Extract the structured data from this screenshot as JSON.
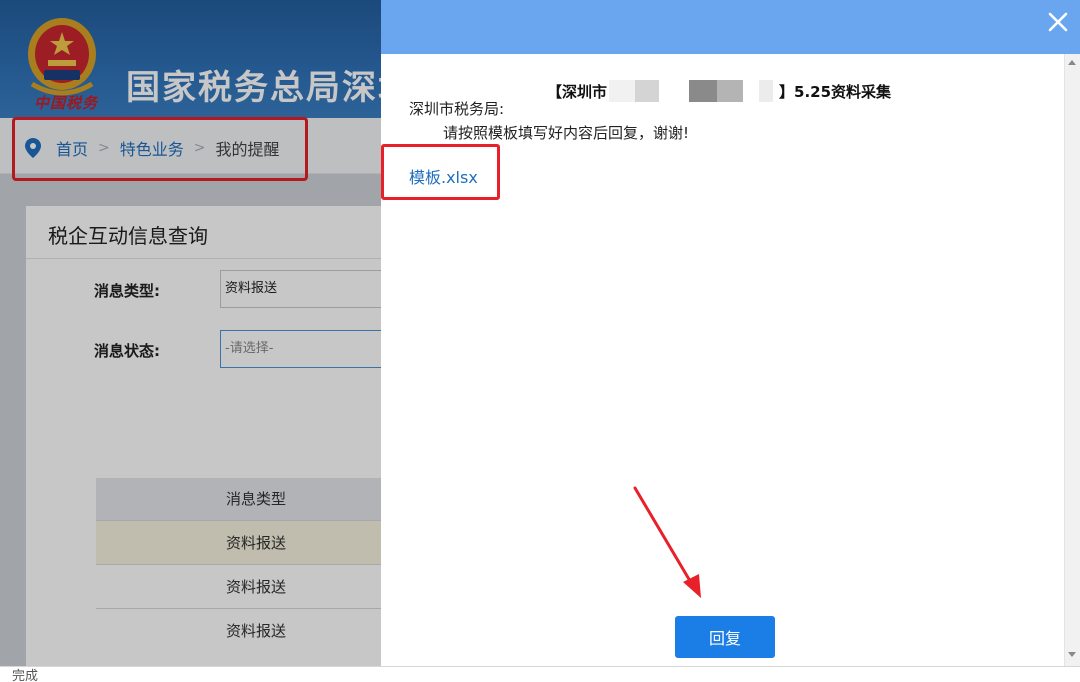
{
  "header": {
    "site_title": "国家税务总局深圳",
    "brand_script": "中国税务"
  },
  "breadcrumb": {
    "home": "首页",
    "category": "特色业务",
    "current": "我的提醒",
    "separator": ">"
  },
  "panel": {
    "title": "税企互动信息查询",
    "fields": {
      "message_type_label": "消息类型:",
      "message_type_value": "资料报送",
      "message_status_label": "消息状态:",
      "message_status_placeholder": "-请选择-"
    },
    "table": {
      "header": "消息类型",
      "rows": [
        "资料报送",
        "资料报送",
        "资料报送"
      ]
    }
  },
  "dialog": {
    "title_prefix": "【深圳市",
    "title_suffix": "】5.25资料采集",
    "greeting": "深圳市税务局:",
    "body": "请按照模板填写好内容后回复，谢谢!",
    "attachment": "模板.xlsx",
    "reply_label": "回复",
    "colors": {
      "header": "#6aa5f0",
      "button": "#1a7ee6",
      "highlight": "#e8202a"
    }
  },
  "status_bar": {
    "text": "完成"
  }
}
